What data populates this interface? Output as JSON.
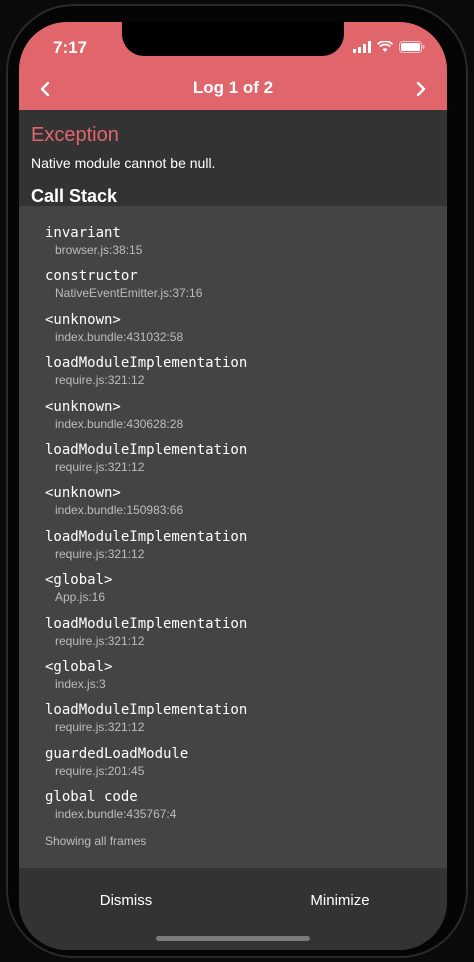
{
  "status": {
    "time": "7:17"
  },
  "nav": {
    "title": "Log 1 of 2"
  },
  "exception": {
    "title": "Exception",
    "message": "Native module cannot be null."
  },
  "callstack": {
    "title": "Call Stack",
    "frames": [
      {
        "name": "invariant",
        "location": "browser.js:38:15"
      },
      {
        "name": "constructor",
        "location": "NativeEventEmitter.js:37:16"
      },
      {
        "name": "<unknown>",
        "location": "index.bundle:431032:58"
      },
      {
        "name": "loadModuleImplementation",
        "location": "require.js:321:12"
      },
      {
        "name": "<unknown>",
        "location": "index.bundle:430628:28"
      },
      {
        "name": "loadModuleImplementation",
        "location": "require.js:321:12"
      },
      {
        "name": "<unknown>",
        "location": "index.bundle:150983:66"
      },
      {
        "name": "loadModuleImplementation",
        "location": "require.js:321:12"
      },
      {
        "name": "<global>",
        "location": "App.js:16"
      },
      {
        "name": "loadModuleImplementation",
        "location": "require.js:321:12"
      },
      {
        "name": "<global>",
        "location": "index.js:3"
      },
      {
        "name": "loadModuleImplementation",
        "location": "require.js:321:12"
      },
      {
        "name": "guardedLoadModule",
        "location": "require.js:201:45"
      },
      {
        "name": "global code",
        "location": "index.bundle:435767:4"
      }
    ],
    "footer": "Showing all frames"
  },
  "bottom": {
    "dismiss_label": "Dismiss",
    "minimize_label": "Minimize"
  },
  "colors": {
    "accent": "#e0666c",
    "panel": "#333333",
    "background": "#444444"
  }
}
